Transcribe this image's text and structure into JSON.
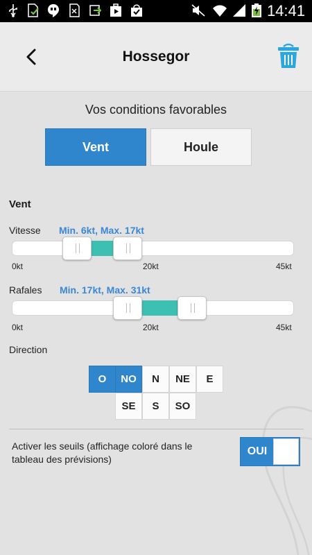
{
  "status_bar": {
    "time": "14:41",
    "icons": [
      "usb-icon",
      "sim-card-icon",
      "hangouts-icon",
      "sd-card-icon",
      "download-icon",
      "play-store-icon",
      "shopping-bag-icon",
      "mute-icon",
      "wifi-icon",
      "signal-icon",
      "battery-icon"
    ]
  },
  "header": {
    "title": "Hossegor",
    "back_icon": "back-arrow-icon",
    "delete_icon": "trash-icon"
  },
  "subtitle": "Vos conditions favorables",
  "tabs": [
    {
      "label": "Vent",
      "active": true
    },
    {
      "label": "Houle",
      "active": false
    }
  ],
  "wind": {
    "title": "Vent",
    "speed": {
      "label": "Vitesse",
      "range_text": "Min. 6kt, Max. 17kt",
      "min": 6,
      "max": 17
    },
    "gusts": {
      "label": "Rafales",
      "range_text": "Min. 17kt, Max. 31kt",
      "min": 17,
      "max": 31
    },
    "scale": {
      "min_label": "0kt",
      "mid_label": "20kt",
      "max_label": "45kt",
      "max": 45
    }
  },
  "direction": {
    "label": "Direction",
    "row1": [
      {
        "label": "O",
        "selected": true
      },
      {
        "label": "NO",
        "selected": true
      },
      {
        "label": "N",
        "selected": false
      },
      {
        "label": "NE",
        "selected": false
      },
      {
        "label": "E",
        "selected": false
      }
    ],
    "row2": [
      {
        "label": "SE",
        "selected": false
      },
      {
        "label": "S",
        "selected": false
      },
      {
        "label": "SO",
        "selected": false
      }
    ]
  },
  "thresholds": {
    "text": "Activer les seuils (affichage coloré dans le tableau des prévisions)",
    "toggle_label": "OUI",
    "enabled": true
  },
  "colors": {
    "accent": "#2f86cc",
    "range_text": "#3a87d6",
    "slider_fill": "#3dbfb2"
  }
}
